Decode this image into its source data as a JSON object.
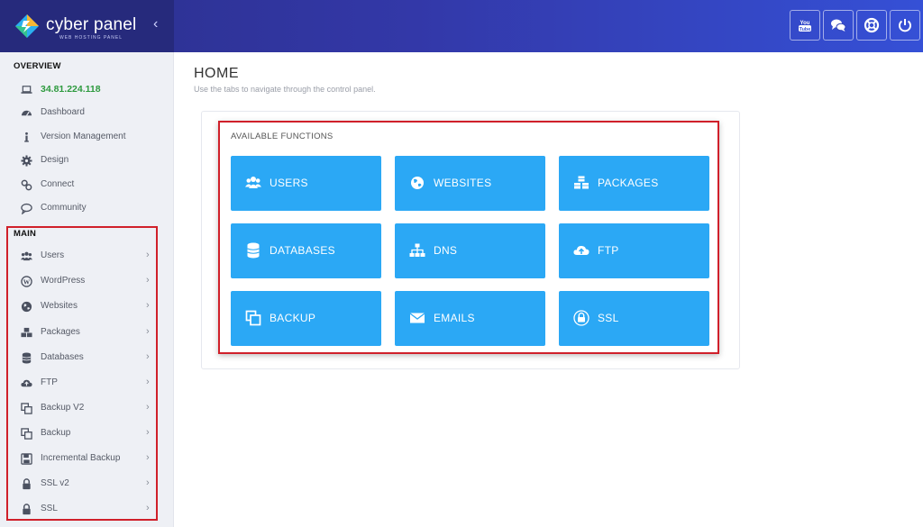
{
  "header": {
    "brand": "cyber panel",
    "brand_sub": "WEB HOSTING PANEL",
    "buttons": [
      {
        "icon": "youtube-icon"
      },
      {
        "icon": "chat-icon"
      },
      {
        "icon": "lifebuoy-icon"
      },
      {
        "icon": "power-icon"
      }
    ]
  },
  "sidebar": {
    "overview_heading": "OVERVIEW",
    "overview_items": [
      {
        "label": "34.81.224.118",
        "icon": "laptop-icon"
      },
      {
        "label": "Dashboard",
        "icon": "dashboard-icon"
      },
      {
        "label": "Version Management",
        "icon": "info-icon"
      },
      {
        "label": "Design",
        "icon": "gear-icon"
      },
      {
        "label": "Connect",
        "icon": "link-icon"
      },
      {
        "label": "Community",
        "icon": "comments-icon"
      }
    ],
    "main_heading": "MAIN",
    "main_items": [
      {
        "label": "Users",
        "icon": "users-icon"
      },
      {
        "label": "WordPress",
        "icon": "wordpress-icon"
      },
      {
        "label": "Websites",
        "icon": "globe-icon"
      },
      {
        "label": "Packages",
        "icon": "cubes-icon"
      },
      {
        "label": "Databases",
        "icon": "database-icon"
      },
      {
        "label": "FTP",
        "icon": "cloud-upload-icon"
      },
      {
        "label": "Backup V2",
        "icon": "copy-icon"
      },
      {
        "label": "Backup",
        "icon": "copy-icon"
      },
      {
        "label": "Incremental Backup",
        "icon": "save-icon"
      },
      {
        "label": "SSL v2",
        "icon": "lock-icon"
      },
      {
        "label": "SSL",
        "icon": "lock-icon"
      }
    ]
  },
  "page": {
    "title": "HOME",
    "subtitle": "Use the tabs to navigate through the control panel."
  },
  "functions": {
    "title": "AVAILABLE FUNCTIONS",
    "tiles": [
      {
        "label": "USERS",
        "icon": "users-icon"
      },
      {
        "label": "WEBSITES",
        "icon": "globe-icon"
      },
      {
        "label": "PACKAGES",
        "icon": "cubes-icon"
      },
      {
        "label": "DATABASES",
        "icon": "database-icon"
      },
      {
        "label": "DNS",
        "icon": "sitemap-icon"
      },
      {
        "label": "FTP",
        "icon": "cloud-upload-icon"
      },
      {
        "label": "BACKUP",
        "icon": "copy-icon"
      },
      {
        "label": "EMAILS",
        "icon": "envelope-icon"
      },
      {
        "label": "SSL",
        "icon": "lock-icon"
      }
    ]
  },
  "colors": {
    "tile": "#2ba8f5",
    "highlight_border": "#d0202a",
    "ip_text": "#2e9a3f"
  }
}
